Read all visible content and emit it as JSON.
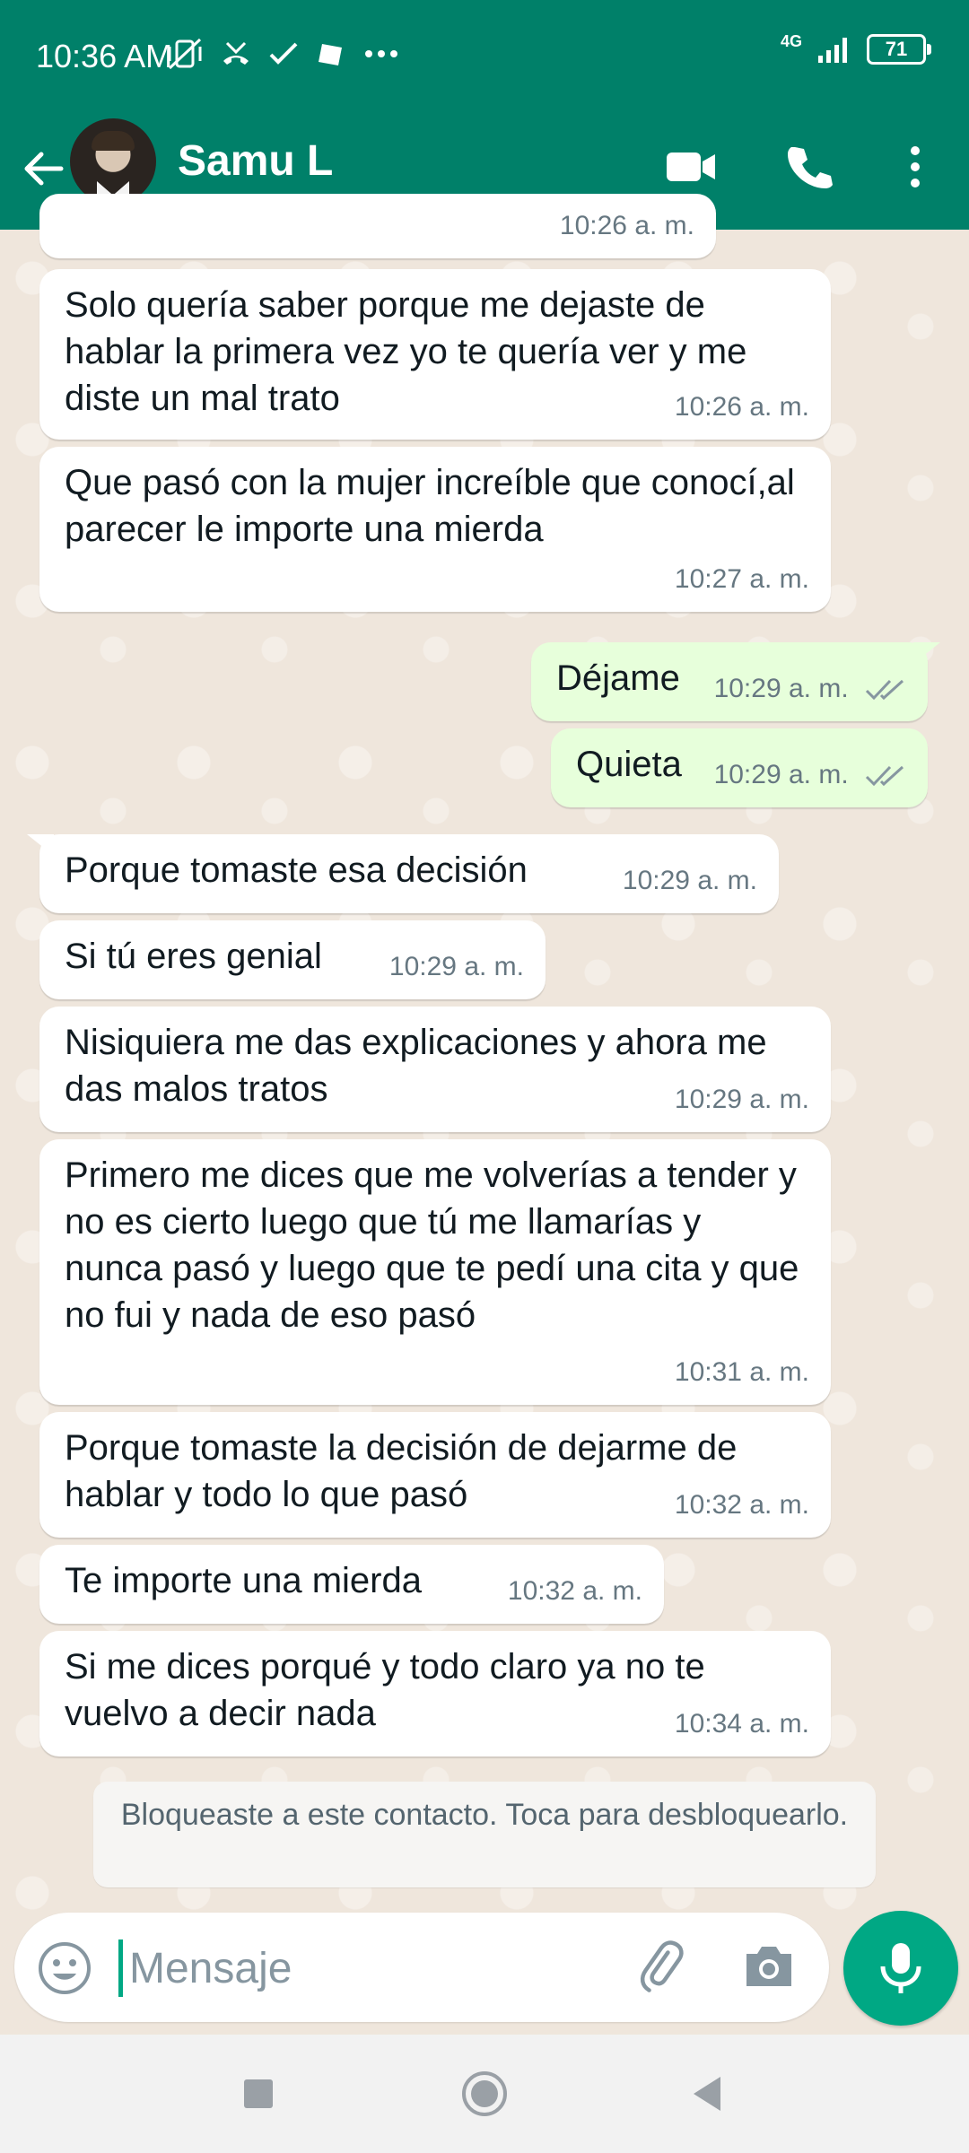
{
  "status_bar": {
    "time": "10:36 AM",
    "network": "4G",
    "battery": "71"
  },
  "header": {
    "contact_name": "Samu L",
    "icons": [
      "back-arrow-icon",
      "video-call-icon",
      "phone-icon",
      "more-options-icon"
    ]
  },
  "messages": [
    {
      "direction": "in",
      "text": "",
      "time": "10:26 a. m."
    },
    {
      "direction": "in",
      "text": "Solo quería saber porque me dejaste de hablar la primera vez yo te quería ver y me diste un mal trato",
      "time": "10:26 a. m."
    },
    {
      "direction": "in",
      "text": "Que pasó con la mujer increíble que conocí,al parecer le importe una mierda",
      "time": "10:27 a. m."
    },
    {
      "direction": "out",
      "text": "Déjame",
      "time": "10:29 a. m.",
      "status": "read"
    },
    {
      "direction": "out",
      "text": "Quieta",
      "time": "10:29 a. m.",
      "status": "read"
    },
    {
      "direction": "in",
      "text": "Porque tomaste esa decisión",
      "time": "10:29 a. m."
    },
    {
      "direction": "in",
      "text": "Si tú eres genial",
      "time": "10:29 a. m."
    },
    {
      "direction": "in",
      "text": "Nisiquiera me das explicaciones y ahora me das malos tratos",
      "time": "10:29 a. m."
    },
    {
      "direction": "in",
      "text": "Primero me dices que me volverías a tender y no es cierto luego que tú me llamarías y nunca pasó y luego que te pedí una cita y que no fui y nada de eso pasó",
      "time": "10:31 a. m."
    },
    {
      "direction": "in",
      "text": "Porque tomaste la decisión de dejarme de hablar y todo lo que pasó",
      "time": "10:32 a. m."
    },
    {
      "direction": "in",
      "text": "Te importe una mierda",
      "time": "10:32 a. m."
    },
    {
      "direction": "in",
      "text": "Si me dices porqué  y todo claro ya no te vuelvo a decir nada",
      "time": "10:34 a. m."
    }
  ],
  "blocked_notice": "Bloqueaste a este contacto. Toca para desbloquearlo.",
  "composer": {
    "placeholder": "Mensaje",
    "value": ""
  },
  "colors": {
    "header": "#008069",
    "accent": "#00A884",
    "outgoing_bubble": "#E7FFDB",
    "incoming_bubble": "#FFFFFF",
    "read_ticks": "#8696A0"
  }
}
